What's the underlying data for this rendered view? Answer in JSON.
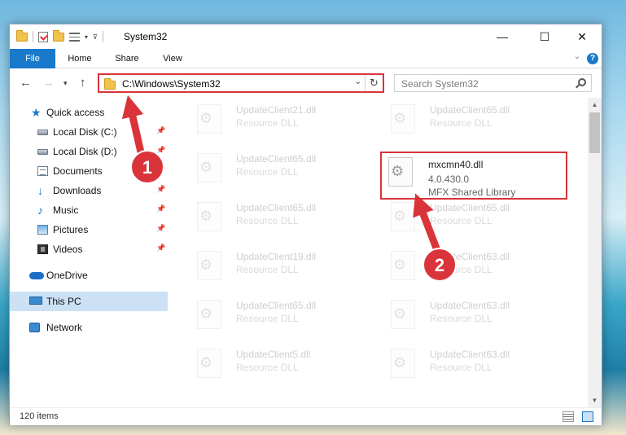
{
  "window": {
    "title": "System32",
    "controls": {
      "minimize": "—",
      "maximize": "☐",
      "close": "✕"
    }
  },
  "ribbon": {
    "tabs": [
      "File",
      "Home",
      "Share",
      "View"
    ],
    "help_icon": "?"
  },
  "navigation": {
    "address": "C:\\Windows\\System32",
    "search_placeholder": "Search System32"
  },
  "sidebar": {
    "items": [
      {
        "label": "Quick access",
        "icon": "star-icon"
      },
      {
        "label": "Local Disk (C:)",
        "icon": "disk-icon",
        "pinned": true
      },
      {
        "label": "Local Disk (D:)",
        "icon": "disk-icon",
        "pinned": true
      },
      {
        "label": "Documents",
        "icon": "documents-icon",
        "pinned": true
      },
      {
        "label": "Downloads",
        "icon": "downloads-icon",
        "pinned": true
      },
      {
        "label": "Music",
        "icon": "music-icon",
        "pinned": true
      },
      {
        "label": "Pictures",
        "icon": "pictures-icon",
        "pinned": true
      },
      {
        "label": "Videos",
        "icon": "videos-icon",
        "pinned": true
      },
      {
        "label": "OneDrive",
        "icon": "onedrive-icon"
      },
      {
        "label": "This PC",
        "icon": "pc-icon",
        "selected": true
      },
      {
        "label": "Network",
        "icon": "network-icon"
      }
    ]
  },
  "files": {
    "left_column": [
      {
        "name": "UpdateClient21.dll",
        "desc": "Resource DLL"
      },
      {
        "name": "UpdateClient65.dll",
        "desc": "Resource DLL"
      },
      {
        "name": "UpdateClient65.dll",
        "desc": "Resource DLL"
      },
      {
        "name": "UpdateClient19.dll",
        "desc": "Resource DLL"
      },
      {
        "name": "UpdateClient65.dll",
        "desc": "Resource DLL"
      },
      {
        "name": "UpdateClient5.dll",
        "desc": "Resource DLL"
      }
    ],
    "right_column": [
      {
        "name": "UpdateClient65.dll",
        "desc": "Resource DLL"
      },
      {
        "name": "UpdateClient65.dll",
        "desc": "Resource DLL"
      },
      {
        "name": "UpdateClient63.dll",
        "desc": "Resource DLL"
      },
      {
        "name": "UpdateClient63.dll",
        "desc": "Resource DLL"
      },
      {
        "name": "UpdateClient63.dll",
        "desc": "Resource DLL"
      }
    ],
    "highlighted": {
      "name": "mxcmn40.dll",
      "version": "4.0.430.0",
      "desc": "MFX Shared Library"
    }
  },
  "status": {
    "item_count": "120 items"
  },
  "annotations": {
    "step1": "1",
    "step2": "2",
    "color": "#d9343a"
  }
}
